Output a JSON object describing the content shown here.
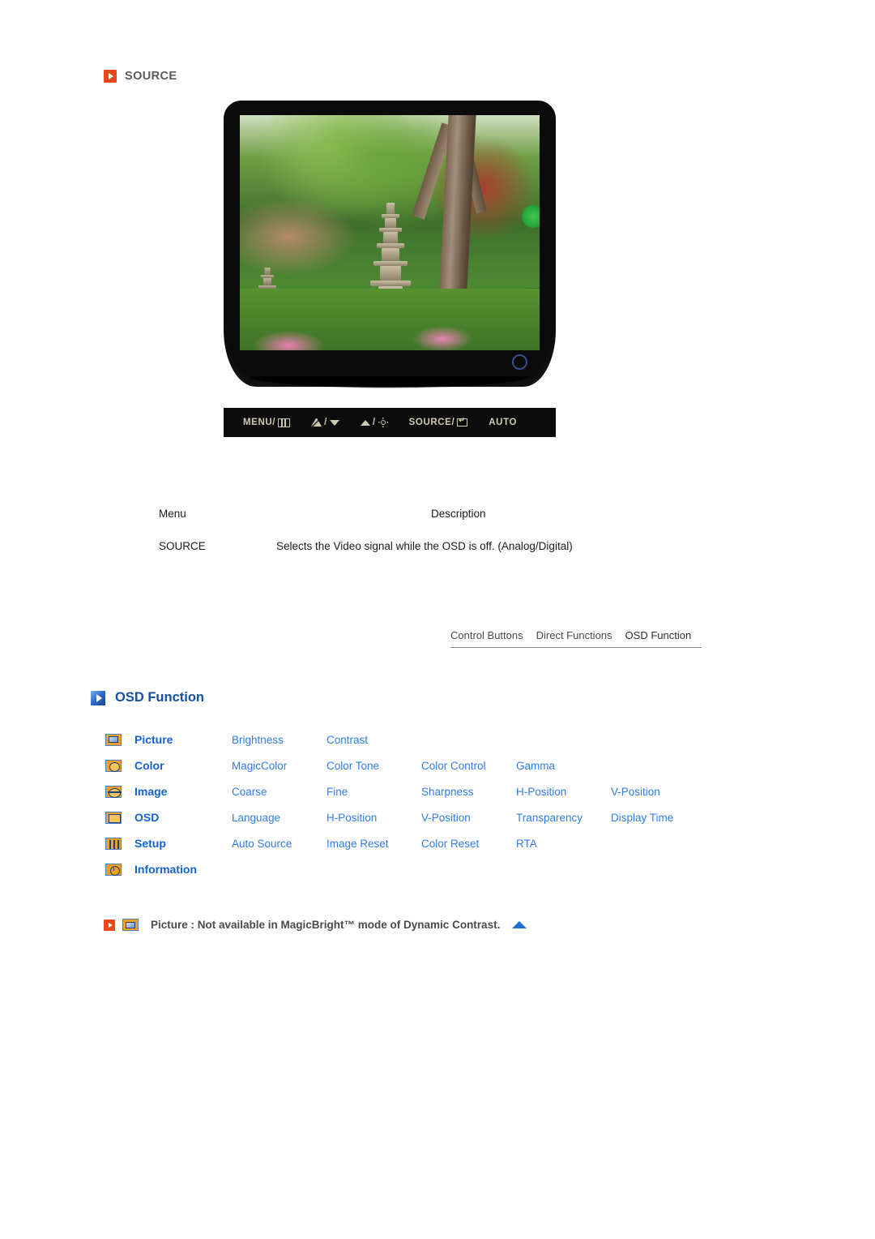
{
  "source_section": {
    "heading": "SOURCE",
    "icon": "orange-play-icon"
  },
  "monitor": {
    "screen_image_description": "Temple garden with stone pagodas, paper lanterns and trees",
    "power_led": "power-indicator",
    "control_buttons": [
      {
        "label_before": "MENU/",
        "glyph": "menu-icon",
        "label_after": ""
      },
      {
        "label_before": "",
        "glyph": "magicbright-icon",
        "label_after": "/",
        "glyph2": "down-arrow-icon"
      },
      {
        "label_before": "",
        "glyph": "up-arrow-icon",
        "label_after": "/",
        "glyph2": "brightness-sun-icon"
      },
      {
        "label_before": "SOURCE/",
        "glyph": "enter-icon",
        "label_after": ""
      },
      {
        "label_before": "AUTO",
        "glyph": "",
        "label_after": ""
      }
    ],
    "control_labels": {
      "menu": "MENU/",
      "slash": "/",
      "source": "SOURCE/",
      "auto": "AUTO"
    }
  },
  "description_table": {
    "headers": {
      "menu": "Menu",
      "description": "Description"
    },
    "rows": [
      {
        "menu": "SOURCE",
        "description": "Selects the Video signal while the OSD is off. (Analog/Digital)"
      }
    ]
  },
  "tabnav": {
    "tabs": [
      {
        "label": "Control Buttons",
        "active": false
      },
      {
        "label": "Direct Functions",
        "active": false
      },
      {
        "label": "OSD Function",
        "active": true
      }
    ]
  },
  "osd_function": {
    "heading": "OSD Function",
    "rows": [
      {
        "icon": "picture-icon",
        "category": "Picture",
        "items": [
          "Brightness",
          "Contrast"
        ]
      },
      {
        "icon": "color-icon",
        "category": "Color",
        "items": [
          "MagicColor",
          "Color Tone",
          "Color Control",
          "Gamma"
        ]
      },
      {
        "icon": "image-icon",
        "category": "Image",
        "items": [
          "Coarse",
          "Fine",
          "Sharpness",
          "H-Position",
          "V-Position"
        ]
      },
      {
        "icon": "osd-icon",
        "category": "OSD",
        "items": [
          "Language",
          "H-Position",
          "V-Position",
          "Transparency",
          "Display Time"
        ]
      },
      {
        "icon": "setup-icon",
        "category": "Setup",
        "items": [
          "Auto Source",
          "Image Reset",
          "Color Reset",
          "RTA"
        ]
      },
      {
        "icon": "information-icon",
        "category": "Information",
        "items": []
      }
    ]
  },
  "note": {
    "text": "Picture : Not available in MagicBright™ mode of Dynamic Contrast.",
    "leading_icon": "orange-play-icon",
    "secondary_icon": "picture-icon",
    "trailing_icon": "blue-up-triangle-icon"
  },
  "colors": {
    "orange_accent": "#e8491c",
    "blue_heading": "#15519e",
    "link_blue": "#2f7dea",
    "category_blue": "#1461d2",
    "icon_gold": "#f0a024",
    "text_gray": "#4a4a4a",
    "bezel_black": "#0b0b0b"
  }
}
